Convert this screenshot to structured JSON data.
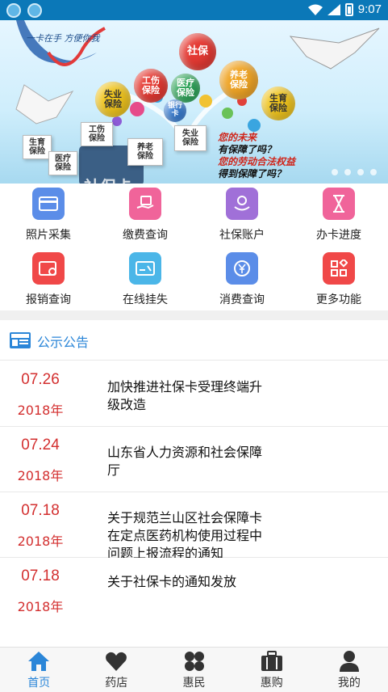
{
  "status_bar": {
    "time": "9:07"
  },
  "banner": {
    "script_text": "一卡在手 方便你我",
    "bubbles": [
      "社保",
      "工伤\n保险",
      "医疗\n保险",
      "养老\n保险",
      "失业\n保险",
      "生育\n保险",
      "银行\n卡"
    ],
    "cards": [
      "工伤\n保险",
      "养老\n保险",
      "失业\n保险",
      "生育\n保险",
      "医疗\n保险"
    ],
    "slogan": [
      "您的未来",
      "有保障了吗？",
      "您的劳动合法权益",
      "得到保障了吗？"
    ],
    "brand": "社保卡"
  },
  "grid": {
    "items": [
      {
        "label": "照片采集",
        "color": "#5b8de8",
        "icon": "card-icon"
      },
      {
        "label": "缴费查询",
        "color": "#f0649a",
        "icon": "payment-hand-icon"
      },
      {
        "label": "社保账户",
        "color": "#a070d8",
        "icon": "account-hand-icon"
      },
      {
        "label": "办卡进度",
        "color": "#f0649a",
        "icon": "hourglass-icon"
      },
      {
        "label": "报销查询",
        "color": "#f04848",
        "icon": "reimburse-icon"
      },
      {
        "label": "在线挂失",
        "color": "#4bb6e8",
        "icon": "report-loss-icon"
      },
      {
        "label": "消费查询",
        "color": "#5b8de8",
        "icon": "yuan-coin-icon"
      },
      {
        "label": "更多功能",
        "color": "#f04848",
        "icon": "more-grid-icon"
      }
    ]
  },
  "notice": {
    "title": "公示公告",
    "items": [
      {
        "md": "07.26",
        "year": "2018年",
        "title": "加快推进社保卡受理终端升级改造"
      },
      {
        "md": "07.24",
        "year": "2018年",
        "title": "山东省人力资源和社会保障厅"
      },
      {
        "md": "07.18",
        "year": "2018年",
        "title": "关于规范兰山区社会保障卡在定点医药机构使用过程中问题上报流程的通知"
      },
      {
        "md": "07.18",
        "year": "2018年",
        "title": "关于社保卡的通知发放"
      }
    ]
  },
  "bottom_nav": [
    {
      "label": "首页",
      "icon": "home-icon",
      "active": true
    },
    {
      "label": "药店",
      "icon": "heart-icon",
      "active": false
    },
    {
      "label": "惠民",
      "icon": "clover-icon",
      "active": false
    },
    {
      "label": "惠购",
      "icon": "briefcase-icon",
      "active": false
    },
    {
      "label": "我的",
      "icon": "user-icon",
      "active": false
    }
  ],
  "colors": {
    "accent": "#2b86d8",
    "date_red": "#d32f2f",
    "status_bar": "#0b78b8"
  }
}
